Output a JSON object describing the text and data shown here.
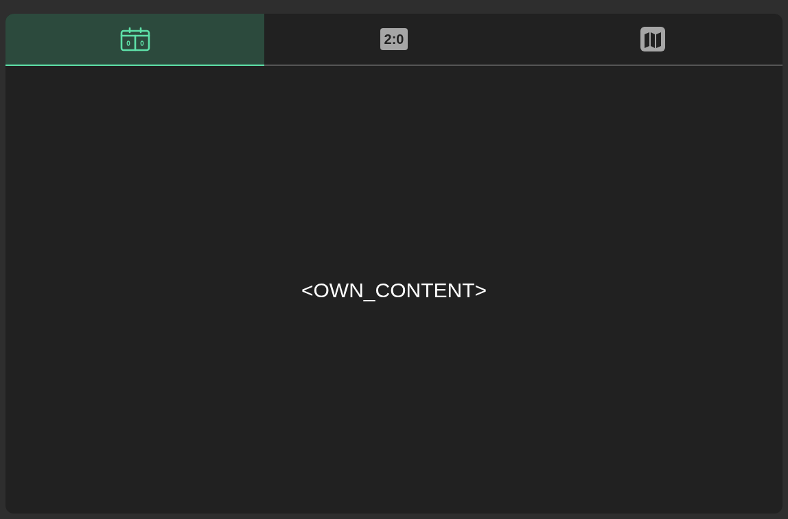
{
  "tabs": [
    {
      "kind": "scoreboard",
      "selected": true
    },
    {
      "kind": "score",
      "text": "2:0",
      "selected": false
    },
    {
      "kind": "map",
      "selected": false
    }
  ],
  "content": {
    "text": "<OWN_CONTENT>"
  }
}
